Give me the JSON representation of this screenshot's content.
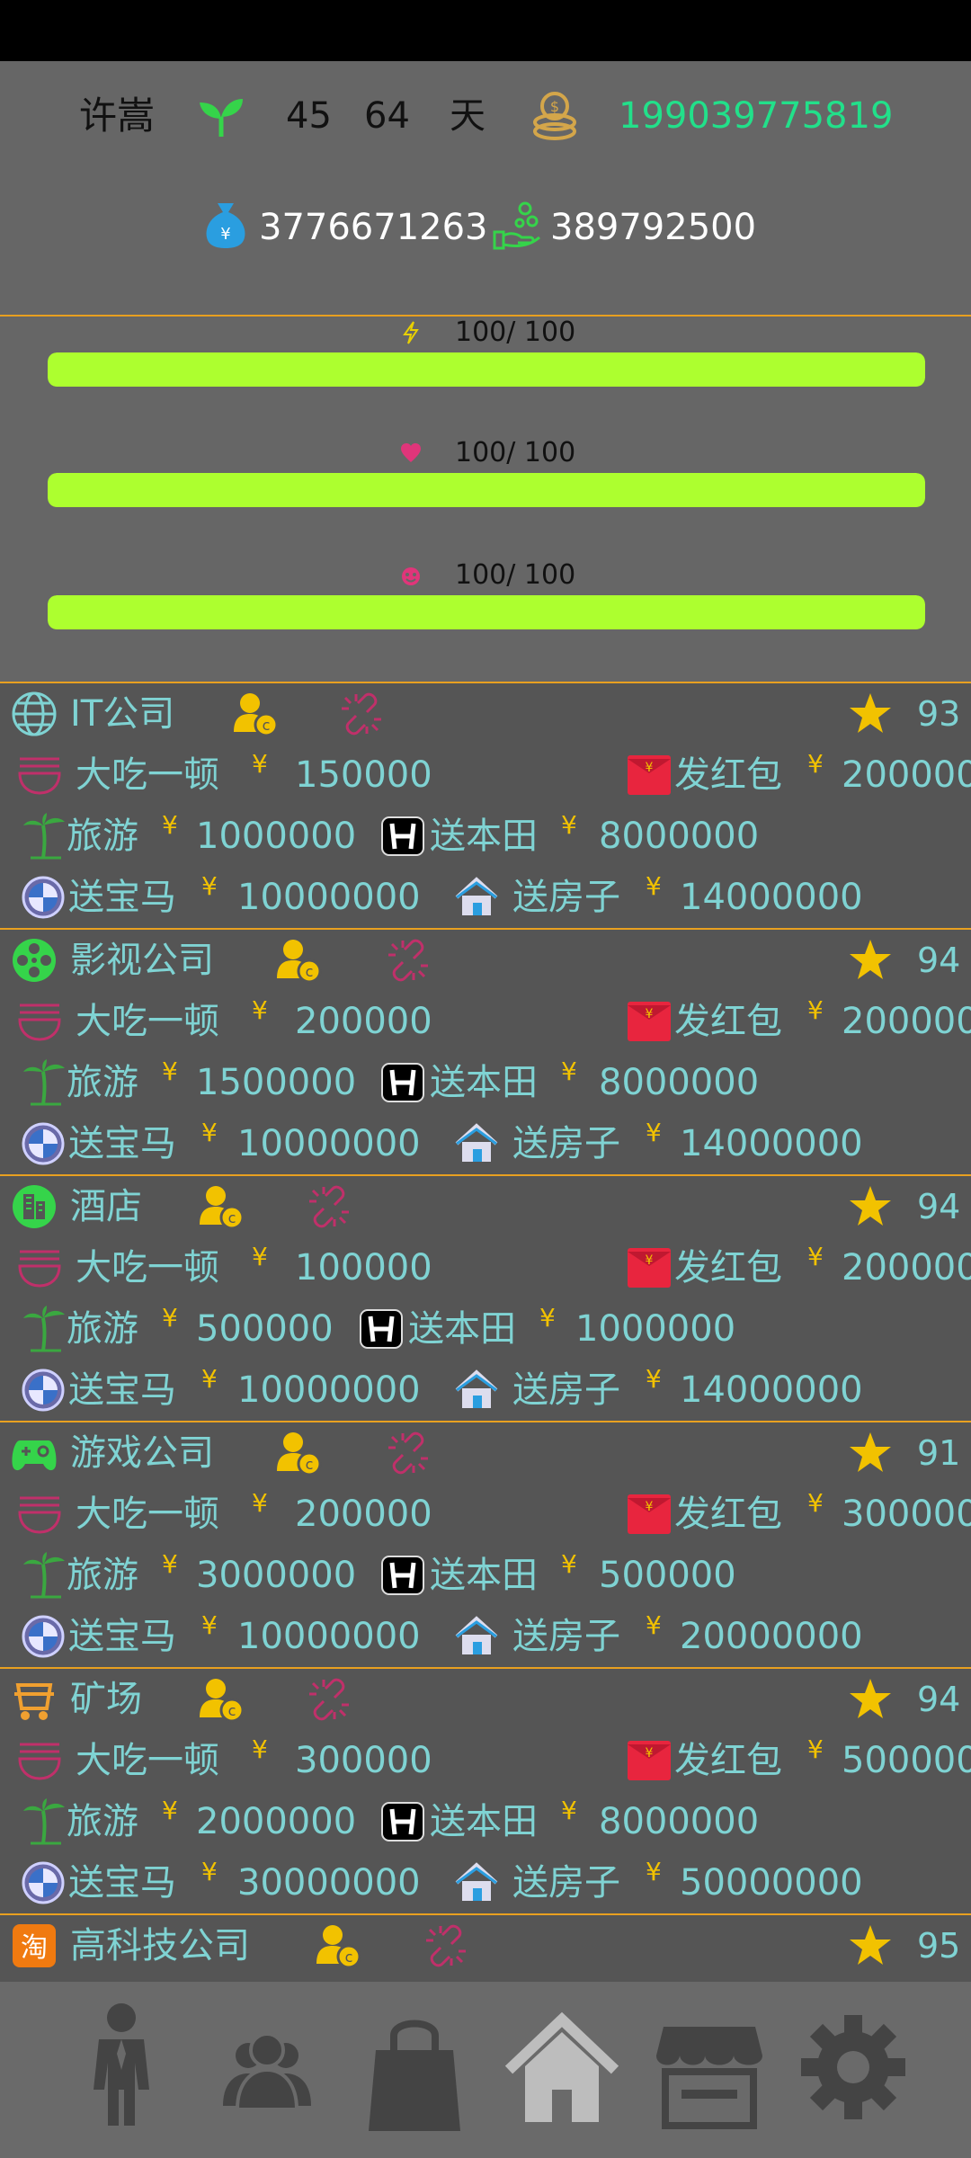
{
  "header": {
    "player_name": "许嵩",
    "age": "45",
    "days": "64",
    "days_unit": "天",
    "cash": "199039775819",
    "savings": "3776671263",
    "income": "389792500",
    "sprout_icon": "sprout-icon",
    "coins_icon": "coin-stack-icon",
    "money_bag_icon": "money-bag-icon",
    "income_icon": "hand-coins-icon"
  },
  "stats": [
    {
      "icon": "lightning-icon",
      "label": "100/ 100",
      "level": 1.0
    },
    {
      "icon": "heart-icon",
      "label": "100/ 100",
      "level": 1.0
    },
    {
      "icon": "mood-icon",
      "label": "100/ 100",
      "level": 1.0
    }
  ],
  "companies": [
    {
      "name": "IT公司",
      "rating": "93",
      "icon": "globe-icon",
      "gifts": [
        {
          "label": "大吃一顿",
          "price": "150000"
        },
        {
          "label": "发红包",
          "price": "200000"
        },
        {
          "label": "旅游",
          "price": "1000000"
        },
        {
          "label": "送本田",
          "price": "8000000"
        },
        {
          "label": "送宝马",
          "price": "10000000"
        },
        {
          "label": "送房子",
          "price": "14000000"
        }
      ]
    },
    {
      "name": "影视公司",
      "rating": "94",
      "icon": "film-reel-icon",
      "gifts": [
        {
          "label": "大吃一顿",
          "price": "200000"
        },
        {
          "label": "发红包",
          "price": "200000"
        },
        {
          "label": "旅游",
          "price": "1500000"
        },
        {
          "label": "送本田",
          "price": "8000000"
        },
        {
          "label": "送宝马",
          "price": "10000000"
        },
        {
          "label": "送房子",
          "price": "14000000"
        }
      ]
    },
    {
      "name": "酒店",
      "rating": "94",
      "icon": "hotel-icon",
      "gifts": [
        {
          "label": "大吃一顿",
          "price": "100000"
        },
        {
          "label": "发红包",
          "price": "200000"
        },
        {
          "label": "旅游",
          "price": "500000"
        },
        {
          "label": "送本田",
          "price": "1000000"
        },
        {
          "label": "送宝马",
          "price": "10000000"
        },
        {
          "label": "送房子",
          "price": "14000000"
        }
      ]
    },
    {
      "name": "游戏公司",
      "rating": "91",
      "icon": "gamepad-icon",
      "gifts": [
        {
          "label": "大吃一顿",
          "price": "200000"
        },
        {
          "label": "发红包",
          "price": "300000"
        },
        {
          "label": "旅游",
          "price": "3000000"
        },
        {
          "label": "送本田",
          "price": "500000"
        },
        {
          "label": "送宝马",
          "price": "10000000"
        },
        {
          "label": "送房子",
          "price": "20000000"
        }
      ]
    },
    {
      "name": "矿场",
      "rating": "94",
      "icon": "mine-cart-icon",
      "gifts": [
        {
          "label": "大吃一顿",
          "price": "300000"
        },
        {
          "label": "发红包",
          "price": "500000"
        },
        {
          "label": "旅游",
          "price": "2000000"
        },
        {
          "label": "送本田",
          "price": "8000000"
        },
        {
          "label": "送宝马",
          "price": "30000000"
        },
        {
          "label": "送房子",
          "price": "50000000"
        }
      ]
    },
    {
      "name": "高科技公司",
      "rating": "95",
      "icon": "taobao-icon",
      "gifts": []
    }
  ],
  "yen": "¥",
  "nav": [
    {
      "name": "profile",
      "icon": "businessman-icon"
    },
    {
      "name": "social",
      "icon": "people-icon"
    },
    {
      "name": "shop",
      "icon": "shopping-bag-icon"
    },
    {
      "name": "home",
      "icon": "home-icon"
    },
    {
      "name": "store",
      "icon": "storefront-icon"
    },
    {
      "name": "settings",
      "icon": "gear-icon"
    }
  ],
  "colors": {
    "accent_green": "#22e08a",
    "bar_fill": "#adff2f",
    "divider": "#e8a020",
    "text_teal": "#7fd3d3",
    "yen": "#f2c200"
  }
}
